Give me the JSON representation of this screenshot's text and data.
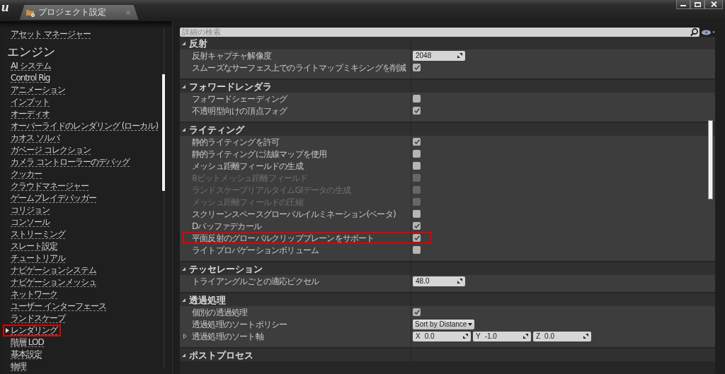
{
  "window": {
    "logo": "u",
    "tabs": [
      {
        "label": "プロジェクト設定",
        "selected": true
      }
    ]
  },
  "sidebar": {
    "groups": [
      {
        "items": [
          {
            "label": "アセット マネージャー",
            "selected": false,
            "highlighted": false
          }
        ]
      },
      {
        "title": "エンジン",
        "items": [
          {
            "label": "AI システム",
            "selected": false,
            "highlighted": false
          },
          {
            "label": "Control Rig",
            "selected": false,
            "highlighted": false
          },
          {
            "label": "アニメーション",
            "selected": false,
            "highlighted": false
          },
          {
            "label": "インプット",
            "selected": false,
            "highlighted": false
          },
          {
            "label": "オーディオ",
            "selected": false,
            "highlighted": false
          },
          {
            "label": "オーバーライドのレンダリング (ローカル)",
            "selected": false,
            "highlighted": false
          },
          {
            "label": "カオス ソルバ",
            "selected": false,
            "highlighted": false
          },
          {
            "label": "ガベージ コレクション",
            "selected": false,
            "highlighted": false
          },
          {
            "label": "カメラ コントローラーのデバッグ",
            "selected": false,
            "highlighted": false
          },
          {
            "label": "クッカー",
            "selected": false,
            "highlighted": false
          },
          {
            "label": "クラウドマネージャー",
            "selected": false,
            "highlighted": false
          },
          {
            "label": "ゲームプレイデバッガー",
            "selected": false,
            "highlighted": false
          },
          {
            "label": "コリジョン",
            "selected": false,
            "highlighted": false
          },
          {
            "label": "コンソール",
            "selected": false,
            "highlighted": false
          },
          {
            "label": "ストリーミング",
            "selected": false,
            "highlighted": false
          },
          {
            "label": "スレート設定",
            "selected": false,
            "highlighted": false
          },
          {
            "label": "チュートリアル",
            "selected": false,
            "highlighted": false
          },
          {
            "label": "ナビゲーションシステム",
            "selected": false,
            "highlighted": false
          },
          {
            "label": "ナビゲーションメッシュ",
            "selected": false,
            "highlighted": false
          },
          {
            "label": "ネットワーク",
            "selected": false,
            "highlighted": false
          },
          {
            "label": "ユーザー インターフェース",
            "selected": false,
            "highlighted": false
          },
          {
            "label": "ランドスケープ",
            "selected": false,
            "highlighted": false
          },
          {
            "label": "レンダリング",
            "selected": true,
            "highlighted": true
          },
          {
            "label": "階層 LOD",
            "selected": false,
            "highlighted": false
          },
          {
            "label": "基本設定",
            "selected": false,
            "highlighted": false
          },
          {
            "label": "物理",
            "selected": false,
            "highlighted": false
          }
        ]
      }
    ]
  },
  "details": {
    "search": {
      "placeholder": "詳細の検索"
    },
    "categories": [
      {
        "title": "反射",
        "expanded": true,
        "rows": [
          {
            "kind": "number",
            "label": "反射キャプチャ解像度",
            "value": "2048",
            "disabled": false,
            "highlighted": false
          },
          {
            "kind": "checkbox",
            "label": "スムーズなサーフェス上でのライトマップミキシングを削減",
            "checked": true,
            "disabled": false,
            "highlighted": false
          }
        ]
      },
      {
        "title": "フォワードレンダラ",
        "expanded": true,
        "rows": [
          {
            "kind": "checkbox",
            "label": "フォワードシェーディング",
            "checked": false,
            "disabled": false,
            "highlighted": false
          },
          {
            "kind": "checkbox",
            "label": "不透明型向けの頂点フォグ",
            "checked": true,
            "disabled": false,
            "highlighted": false
          }
        ]
      },
      {
        "title": "ライティング",
        "expanded": true,
        "rows": [
          {
            "kind": "checkbox",
            "label": "静的ライティングを許可",
            "checked": true,
            "disabled": false,
            "highlighted": false
          },
          {
            "kind": "checkbox",
            "label": "静的ライティングに法線マップを使用",
            "checked": false,
            "disabled": false,
            "highlighted": false
          },
          {
            "kind": "checkbox",
            "label": "メッシュ距離フィールドの生成",
            "checked": false,
            "disabled": false,
            "highlighted": false
          },
          {
            "kind": "checkbox",
            "label": "8ビットメッシュ距離フィールド",
            "checked": false,
            "disabled": true,
            "highlighted": false
          },
          {
            "kind": "checkbox",
            "label": "ランドスケープリアルタイムGIデータの生成",
            "checked": false,
            "disabled": true,
            "highlighted": false
          },
          {
            "kind": "checkbox",
            "label": "メッシュ距離フィールドの圧縮",
            "checked": false,
            "disabled": true,
            "highlighted": false
          },
          {
            "kind": "checkbox",
            "label": "スクリーンスペースグローバルイルミネーション(ベータ)",
            "checked": false,
            "disabled": false,
            "highlighted": false
          },
          {
            "kind": "checkbox",
            "label": "Dバッファデカール",
            "checked": true,
            "disabled": false,
            "highlighted": false
          },
          {
            "kind": "checkbox",
            "label": "平面反射のグローバルクリッププレーンをサポート",
            "checked": true,
            "disabled": false,
            "highlighted": true
          },
          {
            "kind": "checkbox",
            "label": "ライトプロパゲーションボリューム",
            "checked": false,
            "disabled": false,
            "highlighted": false
          }
        ]
      },
      {
        "title": "テッセレーション",
        "expanded": true,
        "rows": [
          {
            "kind": "number",
            "label": "トライアングルごとの適応ピクセル",
            "value": "48.0",
            "disabled": false,
            "highlighted": false
          }
        ]
      },
      {
        "title": "透過処理",
        "expanded": true,
        "rows": [
          {
            "kind": "checkbox",
            "label": "個別の透過処理",
            "checked": true,
            "disabled": false,
            "highlighted": false
          },
          {
            "kind": "dropdown",
            "label": "透過処理のソートポリシー",
            "value": "Sort by Distance",
            "disabled": false,
            "highlighted": false
          },
          {
            "kind": "vector",
            "label": "透過処理のソート軸",
            "expanded": false,
            "components": [
              {
                "axis": "X",
                "value": "0.0"
              },
              {
                "axis": "Y",
                "value": "-1.0"
              },
              {
                "axis": "Z",
                "value": "0.0"
              }
            ],
            "disabled": false,
            "highlighted": false
          }
        ]
      },
      {
        "title": "ポストプロセス",
        "expanded": true
      }
    ]
  }
}
